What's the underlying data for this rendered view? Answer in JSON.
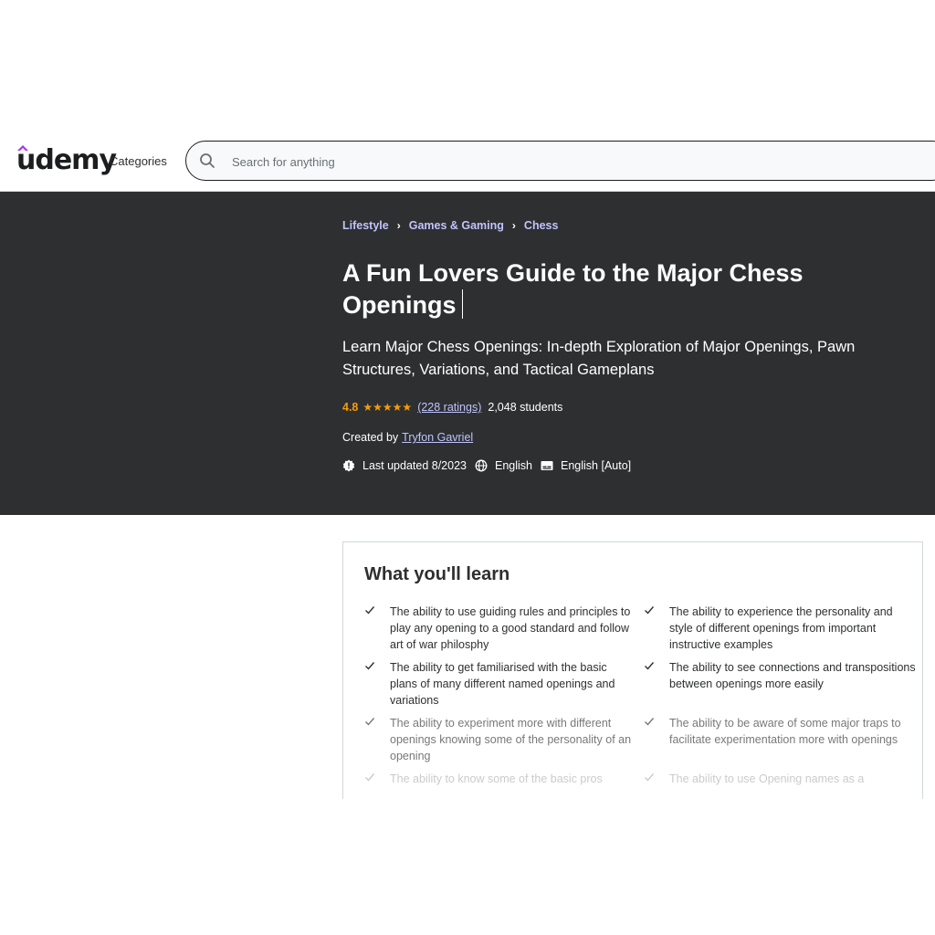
{
  "header": {
    "logo": "udemy",
    "categories": "Categories",
    "search_placeholder": "Search for anything"
  },
  "breadcrumb": [
    "Lifestyle",
    "Games & Gaming",
    "Chess"
  ],
  "course": {
    "title": "A Fun Lovers Guide to the Major Chess Openings",
    "subtitle": "Learn Major Chess Openings: In-depth Exploration of Major Openings, Pawn Structures, Variations, and Tactical Gameplans",
    "rating": "4.8",
    "stars": "★★★★★",
    "ratings_count": "(228 ratings)",
    "students": "2,048 students",
    "created_by_label": "Created by",
    "author": "Tryfon Gavriel",
    "last_updated": "Last updated 8/2023",
    "language": "English",
    "captions": "English [Auto]"
  },
  "learn": {
    "heading": "What you'll learn",
    "items": [
      "The ability to use guiding rules and principles to play any opening to a good standard and follow art of war philosphy",
      "The ability to experience the personality and style of different openings from important instructive examples",
      "The ability to get familiarised with the basic plans of many different named openings and variations",
      "The ability to see connections and transpositions between openings more easily",
      "The ability to experiment more with different openings knowing some of the personality of an opening",
      "The ability to be aware of some major traps to facilitate experimentation more with openings",
      "The ability to know some of the basic pros",
      "The ability to use Opening names as a"
    ]
  },
  "colors": {
    "hero_bg": "#2d2f31",
    "link_purple": "#c0c4fc",
    "star_orange": "#f69c08",
    "logo_accent": "#a435f0"
  }
}
